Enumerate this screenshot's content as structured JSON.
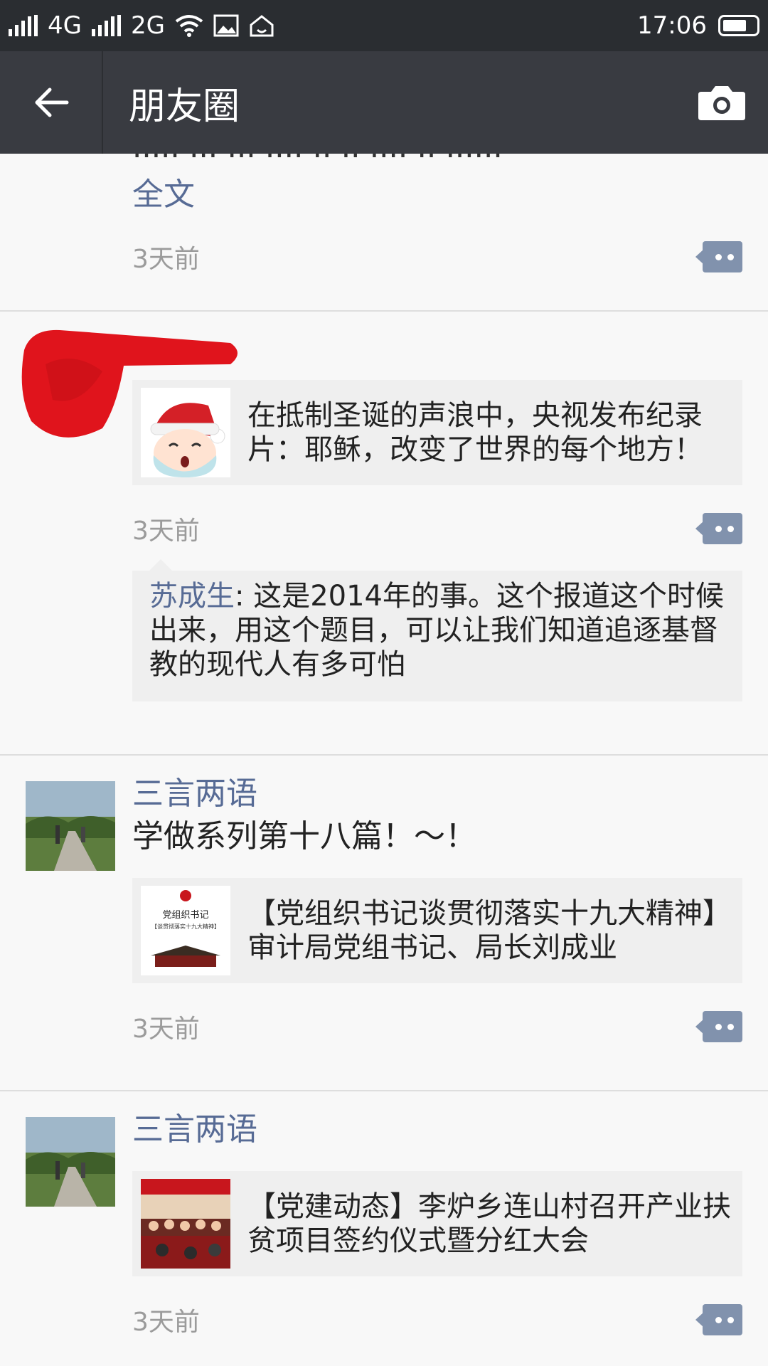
{
  "status_bar": {
    "network1": "4G",
    "network2": "2G",
    "time": "17:06"
  },
  "header": {
    "title": "朋友圈",
    "back_icon": "back-arrow-icon",
    "camera_icon": "camera-icon"
  },
  "top_post": {
    "full_text_link": "全文",
    "time": "3天前"
  },
  "posts": [
    {
      "link_title": "在抵制圣诞的声浪中，央视发布纪录片：耶稣，改变了世界的每个地方！",
      "time": "3天前",
      "comment": {
        "author": "苏成生",
        "separator": ":",
        "text": " 这是2014年的事。这个报道这个时候出来，用这个题目，可以让我们知道追逐基督教的现代人有多可怕"
      }
    },
    {
      "name": "三言两语",
      "text": "学做系列第十八篇！～！",
      "link_title": "【党组织书记谈贯彻落实十九大精神】审计局党组书记、局长刘成业",
      "thumb_title": "党组织书记",
      "thumb_subtitle": "【谈贯彻落实十九大精神】",
      "time": "3天前"
    },
    {
      "name": "三言两语",
      "link_title": "【党建动态】李炉乡连山村召开产业扶贫项目签约仪式暨分红大会",
      "time": "3天前"
    }
  ],
  "colors": {
    "link_blue": "#576b95",
    "nav_bg": "#393b41",
    "status_bg": "#2a2d31"
  }
}
